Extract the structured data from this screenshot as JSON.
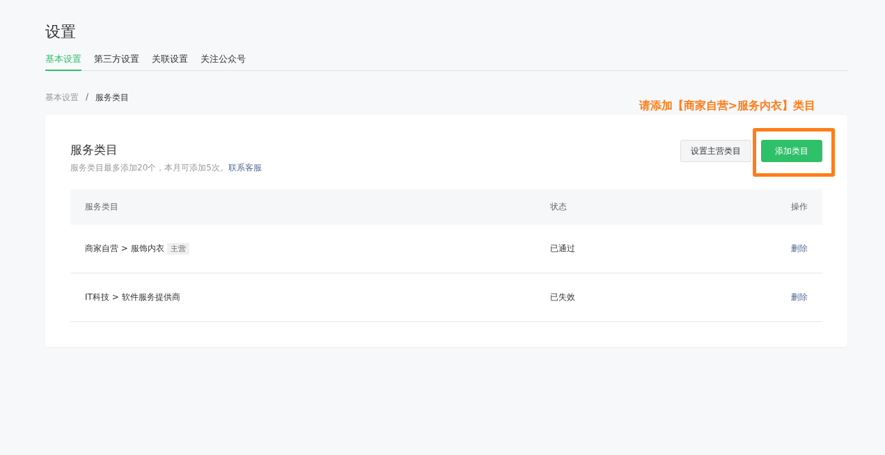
{
  "page_title": "设置",
  "tabs": [
    {
      "label": "基本设置",
      "selected": true
    },
    {
      "label": "第三方设置",
      "selected": false
    },
    {
      "label": "关联设置",
      "selected": false
    },
    {
      "label": "关注公众号",
      "selected": false
    }
  ],
  "breadcrumb": {
    "items": [
      "基本设置",
      "服务类目"
    ],
    "separator": "/"
  },
  "annotation": {
    "text": "请添加【商家自营>服务内衣】类目"
  },
  "card": {
    "title": "服务类目",
    "description": "服务类目最多添加20个，本月可添加5次。",
    "link": "联系客服",
    "buttons": [
      {
        "label": "设置主营类目",
        "kind": "default",
        "highlighted": false
      },
      {
        "label": "添加类目",
        "kind": "primary",
        "highlighted": true
      }
    ],
    "table": {
      "columns": [
        "服务类目",
        "状态",
        "操作"
      ],
      "rows": [
        {
          "category": "商家自营 > 服饰内衣",
          "tag": "主营",
          "status": "已通过",
          "action": "删除"
        },
        {
          "category": "IT科技 > 软件服务提供商",
          "status": "已失效",
          "action": "删除"
        }
      ]
    }
  }
}
